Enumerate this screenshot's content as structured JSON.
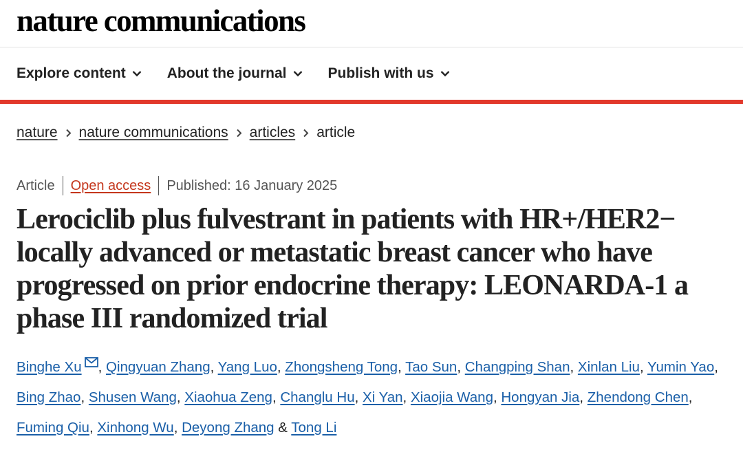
{
  "header": {
    "logo": "nature communications"
  },
  "nav": {
    "items": [
      {
        "label": "Explore content"
      },
      {
        "label": "About the journal"
      },
      {
        "label": "Publish with us"
      }
    ]
  },
  "breadcrumb": {
    "items": [
      {
        "label": "nature"
      },
      {
        "label": "nature communications"
      },
      {
        "label": "articles"
      }
    ],
    "current": "article"
  },
  "meta": {
    "type": "Article",
    "access": "Open access",
    "published": "Published: 16 January 2025"
  },
  "article": {
    "title": "Lerociclib plus fulvestrant in patients with HR+/HER2− locally advanced or metastatic breast cancer who have progressed on prior endocrine therapy: LEONARDA-1 a phase III randomized trial"
  },
  "authors": [
    "Binghe Xu",
    "Qingyuan Zhang",
    "Yang Luo",
    "Zhongsheng Tong",
    "Tao Sun",
    "Changping Shan",
    "Xinlan Liu",
    "Yumin Yao",
    "Bing Zhao",
    "Shusen Wang",
    "Xiaohua Zeng",
    "Changlu Hu",
    "Xi Yan",
    "Xiaojia Wang",
    "Hongyan Jia",
    "Zhendong Chen",
    "Fuming Qiu",
    "Xinhong Wu",
    "Deyong Zhang",
    "Tong Li"
  ],
  "author_separator": ", ",
  "author_final_separator": " & ",
  "colors": {
    "accent": "#e2382b",
    "link": "#1a5fa8",
    "open_access": "#c4361c"
  }
}
